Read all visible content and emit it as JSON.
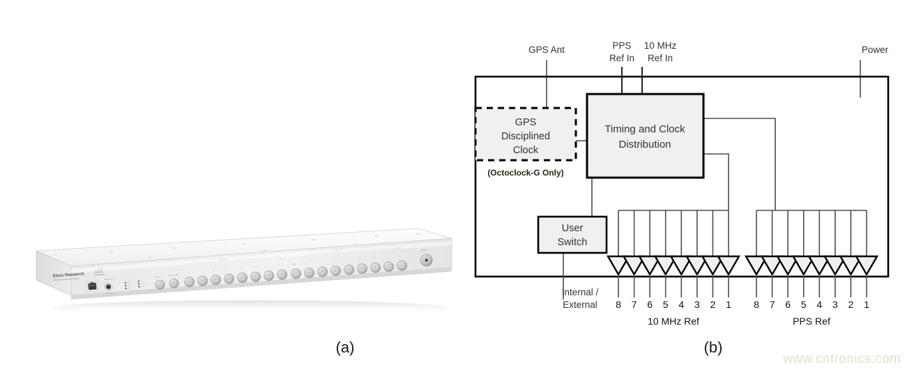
{
  "figure": {
    "caption_a": "(a)",
    "caption_b": "(b)",
    "watermark": "www.cntronics.com"
  },
  "photo": {
    "brand": "Ettus Research",
    "brand_sub": "A National Instruments Company",
    "panel_labels": {
      "ethernet": "",
      "switch_top": "INTERNAL / EXT",
      "switch_bottom": "EXTERNAL",
      "ref_out": "REF OUT",
      "ref_in": "REF IN 10 MHz",
      "bank_10mhz": "10 MHz OUT",
      "pps_in": "PPS IN",
      "bank_pps": "PPS OUT",
      "power": "POWER"
    },
    "bank_numbers": [
      "1",
      "2",
      "3",
      "4",
      "5",
      "6",
      "7",
      "8"
    ],
    "colors": {
      "chassis": "#eceeec",
      "chassis_top": "#f6f7f6",
      "chassis_front": "#e6e8e6",
      "connector": "#cfd2cf"
    }
  },
  "diagram": {
    "top_labels": [
      {
        "id": "gps-ant",
        "text": "GPS Ant",
        "lines": [
          "GPS Ant"
        ]
      },
      {
        "id": "pps-ref-in",
        "text": "PPS Ref In",
        "lines": [
          "PPS",
          "Ref In"
        ]
      },
      {
        "id": "10mhz-ref-in",
        "text": "10 MHz Ref In",
        "lines": [
          "10 MHz",
          "Ref In"
        ]
      },
      {
        "id": "power",
        "text": "Power",
        "lines": [
          "Power"
        ]
      }
    ],
    "blocks": [
      {
        "id": "gps-disciplined-clock",
        "lines": [
          "GPS",
          "Disciplined",
          "Clock"
        ],
        "note": "(Octoclock-G Only)",
        "style": "dashed"
      },
      {
        "id": "timing-clock-distribution",
        "lines": [
          "Timing and Clock",
          "Distribution"
        ],
        "style": "solid"
      },
      {
        "id": "user-switch",
        "lines": [
          "User",
          "Switch"
        ],
        "style": "solid"
      }
    ],
    "bottom_labels": [
      {
        "id": "internal-external",
        "lines": [
          "Internal /",
          "External"
        ]
      }
    ],
    "output_banks": [
      {
        "id": "bank-10mhz-ref",
        "title": "10 MHz Ref",
        "channels": [
          "8",
          "7",
          "6",
          "5",
          "4",
          "3",
          "2",
          "1"
        ]
      },
      {
        "id": "bank-pps-ref",
        "title": "PPS Ref",
        "channels": [
          "8",
          "7",
          "6",
          "5",
          "4",
          "3",
          "2",
          "1"
        ]
      }
    ],
    "colors": {
      "outline": "#000000",
      "block_fill": "#f0f0f0",
      "wire": "#4d4d4d",
      "text": "#333333",
      "note": "#2b2317"
    }
  }
}
